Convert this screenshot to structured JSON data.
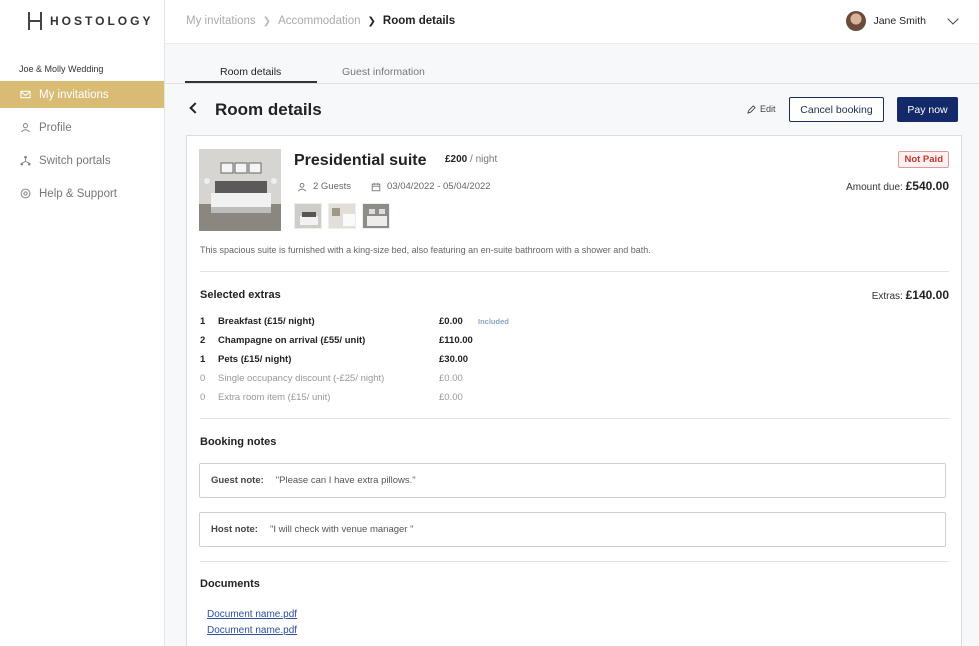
{
  "brand": {
    "name": "HOSTOLOGY"
  },
  "sidebar": {
    "event_name": "Joe & Molly Wedding",
    "items": [
      {
        "label": "My invitations",
        "icon": "mail-icon",
        "active": true
      },
      {
        "label": "Profile",
        "icon": "user-icon",
        "active": false
      },
      {
        "label": "Switch portals",
        "icon": "portal-icon",
        "active": false
      },
      {
        "label": "Help & Support",
        "icon": "help-icon",
        "active": false
      }
    ]
  },
  "header": {
    "breadcrumb": [
      "My invitations",
      "Accommodation",
      "Room details"
    ],
    "user_name": "Jane Smith"
  },
  "tabs": [
    {
      "label": "Room details",
      "active": true
    },
    {
      "label": "Guest information",
      "active": false
    }
  ],
  "page": {
    "title": "Room details",
    "edit_label": "Edit",
    "cancel_label": "Cancel booking",
    "pay_label": "Pay now"
  },
  "room": {
    "name": "Presidential suite",
    "price": "£200",
    "price_unit": "/ night",
    "guests": "2 Guests",
    "dates": "03/04/2022 - 05/04/2022",
    "status": "Not Paid",
    "amount_due_label": "Amount due:",
    "amount_due": "£540.00",
    "description": "This spacious suite is furnished with a king-size bed, also featuring an en-suite bathroom with a shower and bath."
  },
  "extras": {
    "title": "Selected extras",
    "total_label": "Extras:",
    "total": "£140.00",
    "items": [
      {
        "qty": "1",
        "name": "Breakfast (£15/ night)",
        "amount": "£0.00",
        "note": "Included",
        "selected": true
      },
      {
        "qty": "2",
        "name": "Champagne on arrival (£55/ unit)",
        "amount": "£110.00",
        "note": "",
        "selected": true
      },
      {
        "qty": "1",
        "name": "Pets (£15/ night)",
        "amount": "£30.00",
        "note": "",
        "selected": true
      },
      {
        "qty": "0",
        "name": "Single occupancy discount (-£25/ night)",
        "amount": "£0.00",
        "note": "",
        "selected": false
      },
      {
        "qty": "0",
        "name": "Extra room item (£15/ unit)",
        "amount": "£0.00",
        "note": "",
        "selected": false
      }
    ]
  },
  "notes": {
    "title": "Booking notes",
    "guest_label": "Guest note:",
    "guest_value": "\"Please can I have extra pillows.\"",
    "host_label": "Host note:",
    "host_value": "\"I will check with venue manager \""
  },
  "documents": {
    "title": "Documents",
    "files": [
      "Document name.pdf",
      "Document name.pdf"
    ]
  }
}
